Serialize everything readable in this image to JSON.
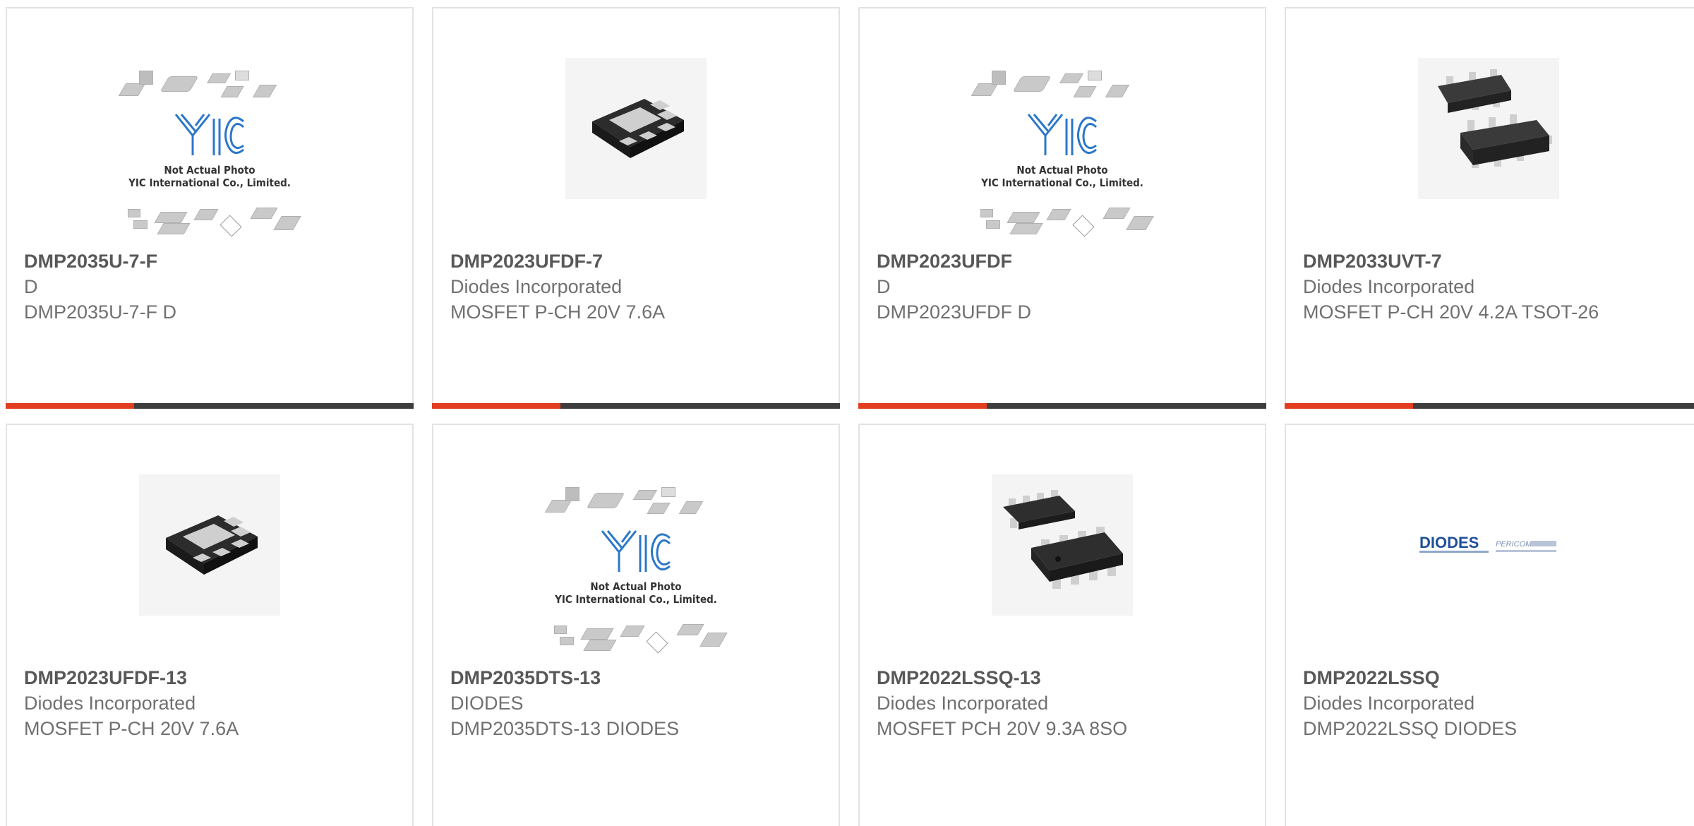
{
  "accent_color": "#e23d1e",
  "bar_color": "#3d3d3d",
  "placeholder": {
    "logo_text": "YIC",
    "line1": "Not Actual Photo",
    "line2": "YIC International Co., Limited."
  },
  "products": [
    {
      "part": "DMP2035U-7-F",
      "manufacturer": "D",
      "description": "DMP2035U-7-F D",
      "image": "yic-placeholder"
    },
    {
      "part": "DMP2023UFDF-7",
      "manufacturer": "Diodes Incorporated",
      "description": "MOSFET P-CH 20V 7.6A",
      "image": "dfn-package-photo"
    },
    {
      "part": "DMP2023UFDF",
      "manufacturer": "D",
      "description": "DMP2023UFDF D",
      "image": "yic-placeholder"
    },
    {
      "part": "DMP2033UVT-7",
      "manufacturer": "Diodes Incorporated",
      "description": "MOSFET P-CH 20V 4.2A TSOT-26",
      "image": "tsot26-package-photo"
    },
    {
      "part": "DMP2023UFDF-13",
      "manufacturer": "Diodes Incorporated",
      "description": "MOSFET P-CH 20V 7.6A",
      "image": "dfn-package-photo"
    },
    {
      "part": "DMP2035DTS-13",
      "manufacturer": "DIODES",
      "description": "DMP2035DTS-13 DIODES",
      "image": "yic-placeholder"
    },
    {
      "part": "DMP2022LSSQ-13",
      "manufacturer": "Diodes Incorporated",
      "description": "MOSFET PCH 20V 9.3A 8SO",
      "image": "so8-package-photo"
    },
    {
      "part": "DMP2022LSSQ",
      "manufacturer": "Diodes Incorporated",
      "description": "DMP2022LSSQ DIODES",
      "image": "diodes-logo"
    }
  ],
  "logo": {
    "brand": "DIODES",
    "partner": "PERICOM"
  }
}
